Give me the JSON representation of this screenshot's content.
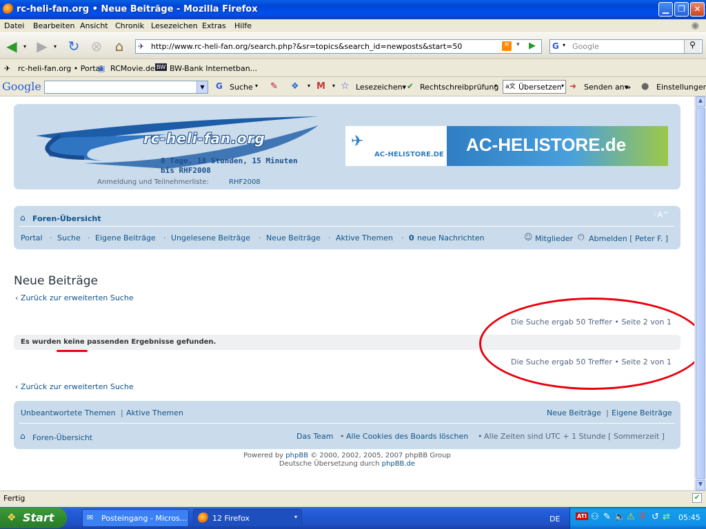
{
  "window": {
    "title": "rc-heli-fan.org • Neue Beiträge - Mozilla Firefox"
  },
  "menu": [
    "Datei",
    "Bearbeiten",
    "Ansicht",
    "Chronik",
    "Lesezeichen",
    "Extras",
    "Hilfe"
  ],
  "nav": {
    "url": "http://www.rc-heli-fan.org/search.php?&sr=topics&search_id=newposts&start=50",
    "search_placeholder": "Google"
  },
  "bookmarks": [
    "rc-heli-fan.org • Portal",
    "RCMovie.de",
    "BW-Bank Internetban..."
  ],
  "gtoolbar": {
    "logo": "Google",
    "suche": "Suche",
    "lesezeichen": "Lesezeichen▾",
    "rechtschreib": "Rechtschreibprüfung",
    "uebersetzen": "Übersetzen",
    "senden": "Senden an▾",
    "mehr": "»",
    "einstellungen": "Einstellungen▾"
  },
  "header": {
    "logo_text": "rc-heli-fan.org",
    "countdown_line1": "8 Tage, 18 Stunden, 15 Minuten",
    "countdown_line2": "bis RHF2008",
    "anmeldung": "Anmeldung und Teilnehmerliste:",
    "anmeldung_link": "RHF2008",
    "ad_small": "AC-HELISTORE.DE",
    "ad_big": "AC-HELISTORE.de"
  },
  "navpanel": {
    "home": "Foren-Übersicht",
    "font_ctrl": "◦A^",
    "links": [
      "Portal",
      "Suche",
      "Eigene Beiträge",
      "Ungelesene Beiträge",
      "Neue Beiträge",
      "Aktive Themen"
    ],
    "msgs_count": "0",
    "msgs_label": "neue Nachrichten",
    "mitglieder": "Mitglieder",
    "abmelden": "Abmelden [ Peter F. ]"
  },
  "main": {
    "title": "Neue Beiträge",
    "back": "Zurück zur erweiterten Suche",
    "result": "Die Suche ergab 50 Treffer • Seite 2 von 1",
    "no_results_1": "Es wurden",
    "no_results_2": "keine",
    "no_results_3": "passenden Ergebnisse gefunden."
  },
  "footer": {
    "unbeantwortet": "Unbeantwortete Themen",
    "sep": "|",
    "aktive": "Aktive Themen",
    "neue": "Neue Beiträge",
    "eigene": "Eigene Beiträge",
    "home": "Foren-Übersicht",
    "team": "Das Team",
    "bullet": "•",
    "cookies": "Alle Cookies des Boards löschen",
    "zeit": "Alle Zeiten sind UTC + 1 Stunde [ Sommerzeit ]",
    "powered": "Powered by",
    "phpbb": "phpBB",
    "copyright": "© 2000, 2002, 2005, 2007 phpBB Group",
    "uebersetzung": "Deutsche Übersetzung durch",
    "phpbbde": "phpBB.de"
  },
  "status": {
    "text": "Fertig"
  },
  "taskbar": {
    "start": "Start",
    "task1": "Posteingang - Micros...",
    "task2": "12 Firefox",
    "lang": "DE",
    "clock": "05:45"
  },
  "colors": {
    "panel": "#cadceb",
    "link": "#105289",
    "annotation": "#e8000c"
  }
}
